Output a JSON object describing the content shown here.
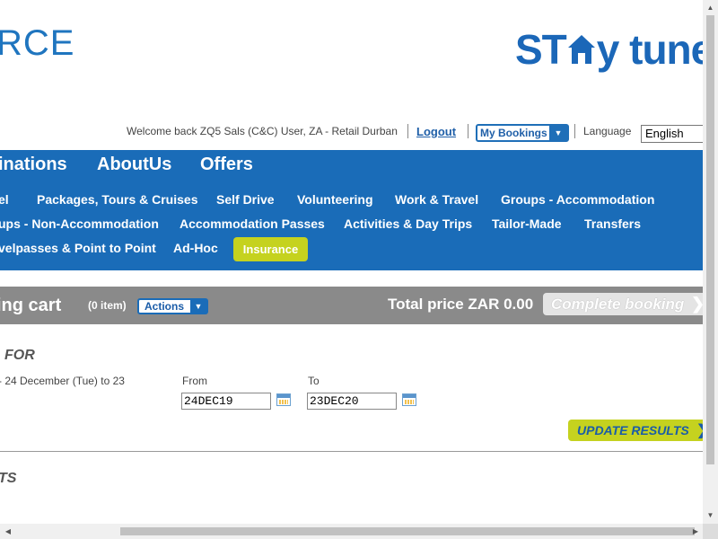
{
  "header": {
    "logo_partial": "RCE",
    "brand_text_1": "ST",
    "brand_text_2": "y tuned",
    "welcome": "Welcome back ZQ5 Sals (C&C) User, ZA - Retail Durban",
    "logout": "Logout",
    "my_bookings": "My Bookings",
    "language_label": "Language",
    "language_value": "English"
  },
  "nav": {
    "main": [
      "inations",
      "AboutUs",
      "Offers"
    ],
    "row1": [
      "el",
      "Packages, Tours & Cruises",
      "Self Drive",
      "Volunteering",
      "Work & Travel",
      "Groups - Accommodation"
    ],
    "row2": [
      "ups - Non-Accommodation",
      "Accommodation Passes",
      "Activities & Day Trips",
      "Tailor-Made",
      "Transfers"
    ],
    "row3": [
      "velpasses & Point to Point",
      "Ad-Hoc"
    ],
    "insurance": "Insurance"
  },
  "cart": {
    "title": "ing cart",
    "count": "(0 item)",
    "actions": "Actions",
    "total": "Total price ZAR 0.00",
    "complete": "Complete booking"
  },
  "search": {
    "title": "FOR",
    "dates_text": "- 24 December (Tue) to 23",
    "from_label": "From",
    "from_value": "24DEC19",
    "to_label": "To",
    "to_value": "23DEC20",
    "update": "UPDATE RESULTS"
  },
  "results": {
    "title": "TS"
  },
  "colors": {
    "nav_blue": "#1a6cb8",
    "accent_lime": "#c5d21f",
    "cart_gray": "#8a8a8a"
  }
}
